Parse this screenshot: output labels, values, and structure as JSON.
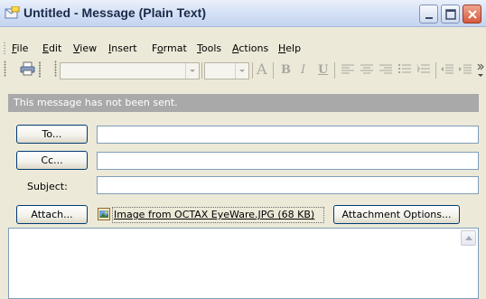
{
  "window": {
    "title": "Untitled - Message (Plain Text)"
  },
  "menu": {
    "items": [
      "File",
      "Edit",
      "View",
      "Insert",
      "Format",
      "Tools",
      "Actions",
      "Help"
    ]
  },
  "toolbar": {
    "font_size_glyph": "A",
    "bold_glyph": "B",
    "italic_glyph": "I",
    "underline_glyph": "U"
  },
  "infobar": {
    "text": "This message has not been sent."
  },
  "form": {
    "to_label": "To...",
    "cc_label": "Cc...",
    "subject_label": "Subject:",
    "attach_label": "Attach...",
    "attachment_options_label": "Attachment Options...",
    "to_value": "",
    "cc_value": "",
    "subject_value": ""
  },
  "attachment": {
    "filename": "Image from OCTAX EyeWare.JPG (68 KB)"
  },
  "body": {
    "text": ""
  }
}
